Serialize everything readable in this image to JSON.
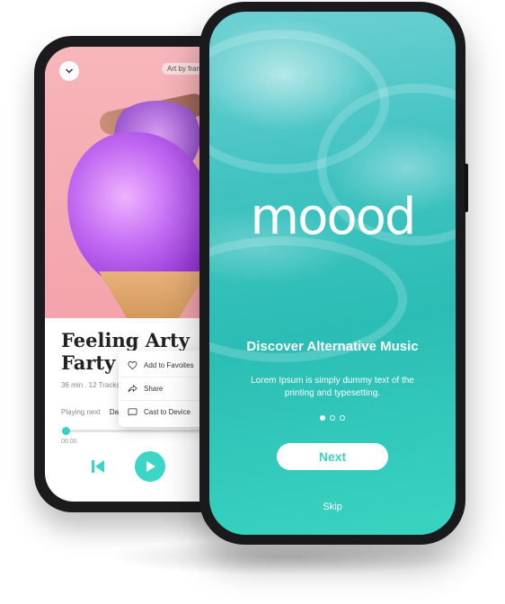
{
  "back_phone": {
    "art_credit": "Art by fran",
    "song_title_line1": "Feeling Arty",
    "song_title_line2": "Farty",
    "meta": "36 min  .  12 Tracks",
    "playing_next_label": "Playing next",
    "playing_next_value": "Da",
    "time": "00:00",
    "progress": 0.02,
    "menu": [
      {
        "label": "Add to Favoites",
        "icon": "heart-icon"
      },
      {
        "label": "Share",
        "icon": "share-icon"
      },
      {
        "label": "Cast to Device",
        "icon": "cast-icon"
      }
    ]
  },
  "front_phone": {
    "logo": "moood",
    "headline": "Discover Alternative Music",
    "description": "Lorem Ipsum is simply dummy text of the printing and typesetting.",
    "page_dots": 3,
    "active_dot": 0,
    "next_label": "Next",
    "skip_label": "Skip"
  },
  "colors": {
    "accent": "#3bd6c6",
    "art_pink": "#f4a3ab"
  }
}
